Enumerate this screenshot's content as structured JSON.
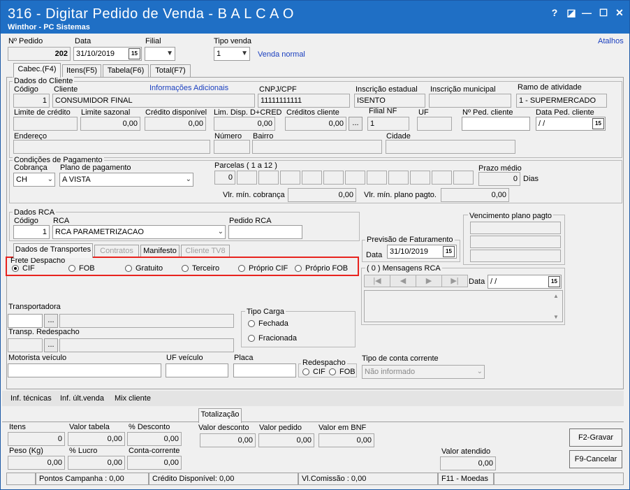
{
  "window": {
    "title": "316 - Digitar Pedido de Venda - B A L C A O",
    "subtitle": "Winthor - PC Sistemas",
    "help_icon": "?",
    "restore_icon": "◪",
    "min_icon": "—",
    "max_icon": "☐",
    "close_icon": "✕"
  },
  "atalhos": "Atalhos",
  "header": {
    "pedido_label": "Nº Pedido",
    "pedido_value": "202",
    "data_label": "Data",
    "data_value": "31/10/2019",
    "filial_label": "Filial",
    "filial_value": "",
    "tipo_venda_label": "Tipo venda",
    "tipo_venda_value": "1",
    "tipo_venda_desc": "Venda normal",
    "cal_icon": "15"
  },
  "tabs": [
    "Cabec.(F4)",
    "Itens(F5)",
    "Tabela(F6)",
    "Total(F7)"
  ],
  "cliente": {
    "group_label": "Dados do Cliente",
    "codigo_label": "Código",
    "codigo_value": "1",
    "cliente_label": "Cliente",
    "cliente_value": "CONSUMIDOR FINAL",
    "info_adicionais": "Informações Adicionais",
    "cnpj_label": "CNPJ/CPF",
    "cnpj_value": "11111111111",
    "ie_label": "Inscrição estadual",
    "ie_value": "ISENTO",
    "im_label": "Inscrição municipal",
    "im_value": "",
    "ramo_label": "Ramo de atividade",
    "ramo_value": "1 - SUPERMERCADO",
    "limite_credito_label": "Limite de crédito",
    "limite_credito_value": "",
    "limite_sazonal_label": "Limite sazonal",
    "limite_sazonal_value": "0,00",
    "credito_disp_label": "Crédito disponível",
    "credito_disp_value": "0,00",
    "lim_disp_label": "Lim. Disp. D+CRED",
    "lim_disp_value": "0,00",
    "creditos_cliente_label": "Créditos cliente",
    "creditos_cliente_value": "0,00",
    "ellipsis": "...",
    "filial_nf_label": "Filial NF",
    "filial_nf_value": "1",
    "uf_label": "UF",
    "uf_value": "",
    "num_ped_cliente_label": "Nº Ped. cliente",
    "num_ped_cliente_value": "",
    "data_ped_cliente_label": "Data Ped. cliente",
    "data_ped_cliente_value": "/ /",
    "endereco_label": "Endereço",
    "numero_label": "Número",
    "bairro_label": "Bairro",
    "cidade_label": "Cidade"
  },
  "pagamento": {
    "group_label": "Condições de Pagamento",
    "cobranca_label": "Cobrança",
    "cobranca_value": "CH",
    "plano_label": "Plano de pagamento",
    "plano_value": "A VISTA",
    "parcelas_label": "Parcelas ( 1 a 12 )",
    "parcela_1": "0",
    "prazo_medio_label": "Prazo médio",
    "prazo_medio_value": "0",
    "dias_label": "Dias",
    "vlr_min_cobranca_label": "Vlr. mín. cobrança",
    "vlr_min_cobranca_value": "0,00",
    "vlr_min_plano_label": "Vlr. mín. plano pagto.",
    "vlr_min_plano_value": "0,00"
  },
  "rca": {
    "group_label": "Dados RCA",
    "codigo_label": "Código",
    "codigo_value": "1",
    "rca_label": "RCA",
    "rca_value": "RCA PARAMETRIZACAO",
    "pedido_rca_label": "Pedido RCA",
    "pedido_rca_value": ""
  },
  "vencimento_label": "Vencimento plano pagto",
  "previsao": {
    "label": "Previsão de Faturamento",
    "data_label": "Data",
    "data_value": "31/10/2019"
  },
  "subtabs": [
    "Dados de Transportes",
    "Contratos",
    "Manifesto",
    "Cliente TV8"
  ],
  "frete": {
    "label": "Frete Despacho",
    "options": [
      "CIF",
      "FOB",
      "Gratuito",
      "Terceiro",
      "Próprio CIF",
      "Próprio FOB"
    ],
    "selected": 0
  },
  "mensagens": {
    "label": "( 0 ) Mensagens RCA",
    "data_label": "Data",
    "data_value": "/ /",
    "nav": [
      "|◀",
      "◀",
      "▶",
      "▶|"
    ]
  },
  "transporte": {
    "transportadora_label": "Transportadora",
    "transp_redespacho_label": "Transp. Redespacho",
    "tipo_carga_label": "Tipo Carga",
    "fechada": "Fechada",
    "fracionada": "Fracionada",
    "motorista_label": "Motorista veículo",
    "uf_veiculo_label": "UF veículo",
    "placa_label": "Placa",
    "redespacho_label": "Redespacho",
    "redespacho_cif": "CIF",
    "redespacho_fob": "FOB",
    "tipo_conta_label": "Tipo de conta corrente",
    "tipo_conta_value": "Não informado"
  },
  "links": [
    "Inf. técnicas",
    "Inf. últ.venda",
    "Mix cliente"
  ],
  "totalizacao": {
    "tab_label": "Totalização",
    "itens_label": "Itens",
    "itens_value": "0",
    "valor_tabela_label": "Valor tabela",
    "valor_tabela_value": "0,00",
    "pct_desconto_label": "% Desconto",
    "pct_desconto_value": "0,00",
    "valor_desconto_label": "Valor desconto",
    "valor_desconto_value": "0,00",
    "valor_pedido_label": "Valor pedido",
    "valor_pedido_value": "0,00",
    "valor_bnf_label": "Valor em BNF",
    "valor_bnf_value": "0,00",
    "peso_label": "Peso (Kg)",
    "peso_value": "0,00",
    "pct_lucro_label": "% Lucro",
    "pct_lucro_value": "0,00",
    "conta_corrente_label": "Conta-corrente",
    "conta_corrente_value": "0,00",
    "valor_atendido_label": "Valor atendido",
    "valor_atendido_value": "0,00",
    "gravar": "F2-Gravar",
    "cancelar": "F9-Cancelar"
  },
  "status": {
    "pontos": "Pontos Campanha : 0,00",
    "credito": "Crédito Disponível: 0,00",
    "comissao": "Vl.Comissão : 0,00",
    "moedas": "F11 - Moedas"
  },
  "colors": {
    "titlebar": "#1f6fc5",
    "highlight": "#e8231e",
    "link": "#1a3fbf"
  }
}
